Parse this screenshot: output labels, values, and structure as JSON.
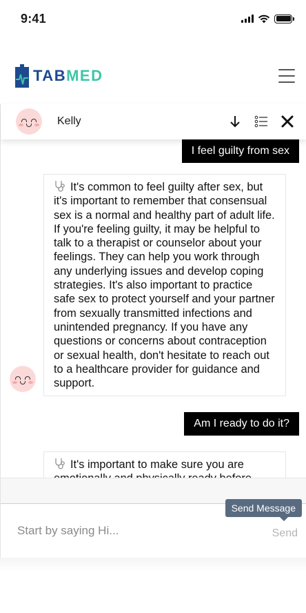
{
  "status_bar": {
    "time": "9:41",
    "icons": [
      "cellular-signal-icon",
      "wifi-icon",
      "battery-icon"
    ]
  },
  "header": {
    "logo_part1": "TAB",
    "logo_part2": "MED",
    "menu_icon": "hamburger-menu-icon",
    "colors": {
      "brand_blue": "#1d4a8f",
      "brand_green": "#3cc6a8"
    }
  },
  "chat": {
    "contact_name": "Kelly",
    "actions": [
      "arrow-down-icon",
      "list-icon",
      "close-icon"
    ],
    "messages": [
      {
        "sender": "user",
        "text": "I feel guilty from sex"
      },
      {
        "sender": "bot",
        "text": "It's common to feel guilty after sex, but it's important to remember that consensual sex is a normal and healthy part of adult life. If you're feeling guilty, it may be helpful to talk to a therapist or counselor about your feelings. They can help you work through any underlying issues and develop coping strategies. It's also important to practice safe sex to protect yourself and your partner from sexually transmitted infections and unintended pregnancy. If you have any questions or concerns about contraception or sexual health, don't hesitate to reach out to a healthcare provider for guidance and support."
      },
      {
        "sender": "user",
        "text": "Am I ready to do it?"
      },
      {
        "sender": "bot",
        "text": "It's important to make sure you are emotionally and physically ready before"
      }
    ]
  },
  "composer": {
    "placeholder": "Start by saying Hi...",
    "value": "",
    "send_label": "Send",
    "tooltip": "Send Message"
  }
}
